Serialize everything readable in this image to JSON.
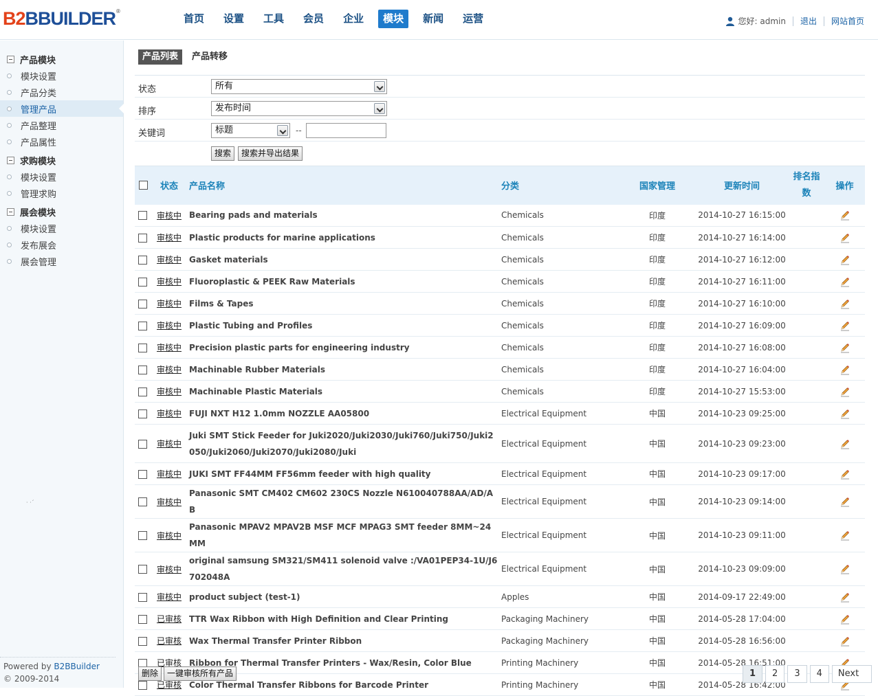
{
  "logo": {
    "part1": "B",
    "part2": "2",
    "part3": "BBUILDER",
    "reg": "®"
  },
  "nav": [
    "首页",
    "设置",
    "工具",
    "会员",
    "企业",
    "模块",
    "新闻",
    "运营"
  ],
  "nav_active_index": 5,
  "user": {
    "greeting": "您好: admin",
    "logout": "退出",
    "home": "网站首页"
  },
  "sidebar": {
    "groups": [
      {
        "title": "产品模块",
        "items": [
          "模块设置",
          "产品分类",
          "管理产品",
          "产品整理",
          "产品属性"
        ]
      },
      {
        "title": "求购模块",
        "items": [
          "模块设置",
          "管理求购"
        ]
      },
      {
        "title": "展会模块",
        "items": [
          "模块设置",
          "发布展会",
          "展会管理"
        ]
      }
    ],
    "active_item": "管理产品",
    "footer": {
      "powered_prefix": "Powered by ",
      "powered_link": "B2BBuilder",
      "copyright": "© 2009-2014"
    }
  },
  "tabs": {
    "list": "产品列表",
    "transfer": "产品转移"
  },
  "filter": {
    "status_label": "状态",
    "status_value": "所有",
    "sort_label": "排序",
    "sort_value": "发布时间",
    "keyword_label": "关键词",
    "keyword_field": "标题",
    "keyword_dash": "--",
    "search_btn": "搜索",
    "export_btn": "搜索并导出结果"
  },
  "table": {
    "headers": {
      "status": "状态",
      "name": "产品名称",
      "category": "分类",
      "country": "国家管理",
      "updated": "更新时间",
      "rank_line1": "排名指",
      "rank_line2": "数",
      "action": "操作"
    },
    "rows": [
      {
        "status": "审核中",
        "name": "Bearing pads and materials",
        "category": "Chemicals",
        "country": "印度",
        "time": "2014-10-27 16:15:00"
      },
      {
        "status": "审核中",
        "name": "Plastic products for marine applications",
        "category": "Chemicals",
        "country": "印度",
        "time": "2014-10-27 16:14:00"
      },
      {
        "status": "审核中",
        "name": "Gasket materials",
        "category": "Chemicals",
        "country": "印度",
        "time": "2014-10-27 16:12:00"
      },
      {
        "status": "审核中",
        "name": "Fluoroplastic & PEEK Raw Materials",
        "category": "Chemicals",
        "country": "印度",
        "time": "2014-10-27 16:11:00"
      },
      {
        "status": "审核中",
        "name": "Films & Tapes",
        "category": "Chemicals",
        "country": "印度",
        "time": "2014-10-27 16:10:00"
      },
      {
        "status": "审核中",
        "name": "Plastic Tubing and Profiles",
        "category": "Chemicals",
        "country": "印度",
        "time": "2014-10-27 16:09:00"
      },
      {
        "status": "审核中",
        "name": "Precision plastic parts for engineering industry",
        "category": "Chemicals",
        "country": "印度",
        "time": "2014-10-27 16:08:00"
      },
      {
        "status": "审核中",
        "name": "Machinable Rubber Materials",
        "category": "Chemicals",
        "country": "印度",
        "time": "2014-10-27 16:04:00"
      },
      {
        "status": "审核中",
        "name": "Machinable Plastic Materials",
        "category": "Chemicals",
        "country": "印度",
        "time": "2014-10-27 15:53:00"
      },
      {
        "status": "审核中",
        "name": "FUJI NXT H12 1.0mm NOZZLE AA05800",
        "category": "Electrical Equipment",
        "country": "中国",
        "time": "2014-10-23 09:25:00"
      },
      {
        "status": "审核中",
        "name": "Juki SMT Stick Feeder for Juki2020/Juki2030/Juki760/Juki750/Juki2050/Juki2060/Juki2070/Juki2080/Juki",
        "category": "Electrical Equipment",
        "country": "中国",
        "time": "2014-10-23 09:23:00"
      },
      {
        "status": "审核中",
        "name": "JUKI SMT FF44MM FF56mm feeder with high quality",
        "category": "Electrical Equipment",
        "country": "中国",
        "time": "2014-10-23 09:17:00"
      },
      {
        "status": "审核中",
        "name": "Panasonic SMT CM402 CM602 230CS Nozzle N610040788AA/AD/AB",
        "category": "Electrical Equipment",
        "country": "中国",
        "time": "2014-10-23 09:14:00"
      },
      {
        "status": "审核中",
        "name": "Panasonic MPAV2 MPAV2B MSF MCF MPAG3 SMT feeder 8MM~24MM",
        "category": "Electrical Equipment",
        "country": "中国",
        "time": "2014-10-23 09:11:00"
      },
      {
        "status": "审核中",
        "name": "original samsung SM321/SM411 solenoid valve :/VA01PEP34-1U/J6702048A",
        "category": "Electrical Equipment",
        "country": "中国",
        "time": "2014-10-23 09:09:00"
      },
      {
        "status": "审核中",
        "name": "product subject (test-1)",
        "category": "Apples",
        "country": "中国",
        "time": "2014-09-17 22:49:00"
      },
      {
        "status": "已审核",
        "name": "TTR Wax Ribbon with High Definition and Clear Printing",
        "category": "Packaging Machinery",
        "country": "中国",
        "time": "2014-05-28 17:04:00"
      },
      {
        "status": "已审核",
        "name": "Wax Thermal Transfer Printer Ribbon",
        "category": "Packaging Machinery",
        "country": "中国",
        "time": "2014-05-28 16:56:00"
      },
      {
        "status": "已审核",
        "name": "Ribbon for Thermal Transfer Printers - Wax/Resin, Color Blue",
        "category": "Printing Machinery",
        "country": "中国",
        "time": "2014-05-28 16:51:00"
      },
      {
        "status": "已审核",
        "name": "Color Thermal Transfer Ribbons for Barcode Printer",
        "category": "Printing Machinery",
        "country": "中国",
        "time": "2014-05-28 16:42:00"
      }
    ]
  },
  "bottom": {
    "delete_btn": "删除",
    "approve_all_btn": "一键审核所有产品"
  },
  "pager": {
    "pages": [
      "1",
      "2",
      "3",
      "4"
    ],
    "current": "1",
    "next": "Next"
  },
  "colors": {
    "accent": "#1f7bcc",
    "header_text": "#1c83b9",
    "active_bg": "#deebf5"
  }
}
